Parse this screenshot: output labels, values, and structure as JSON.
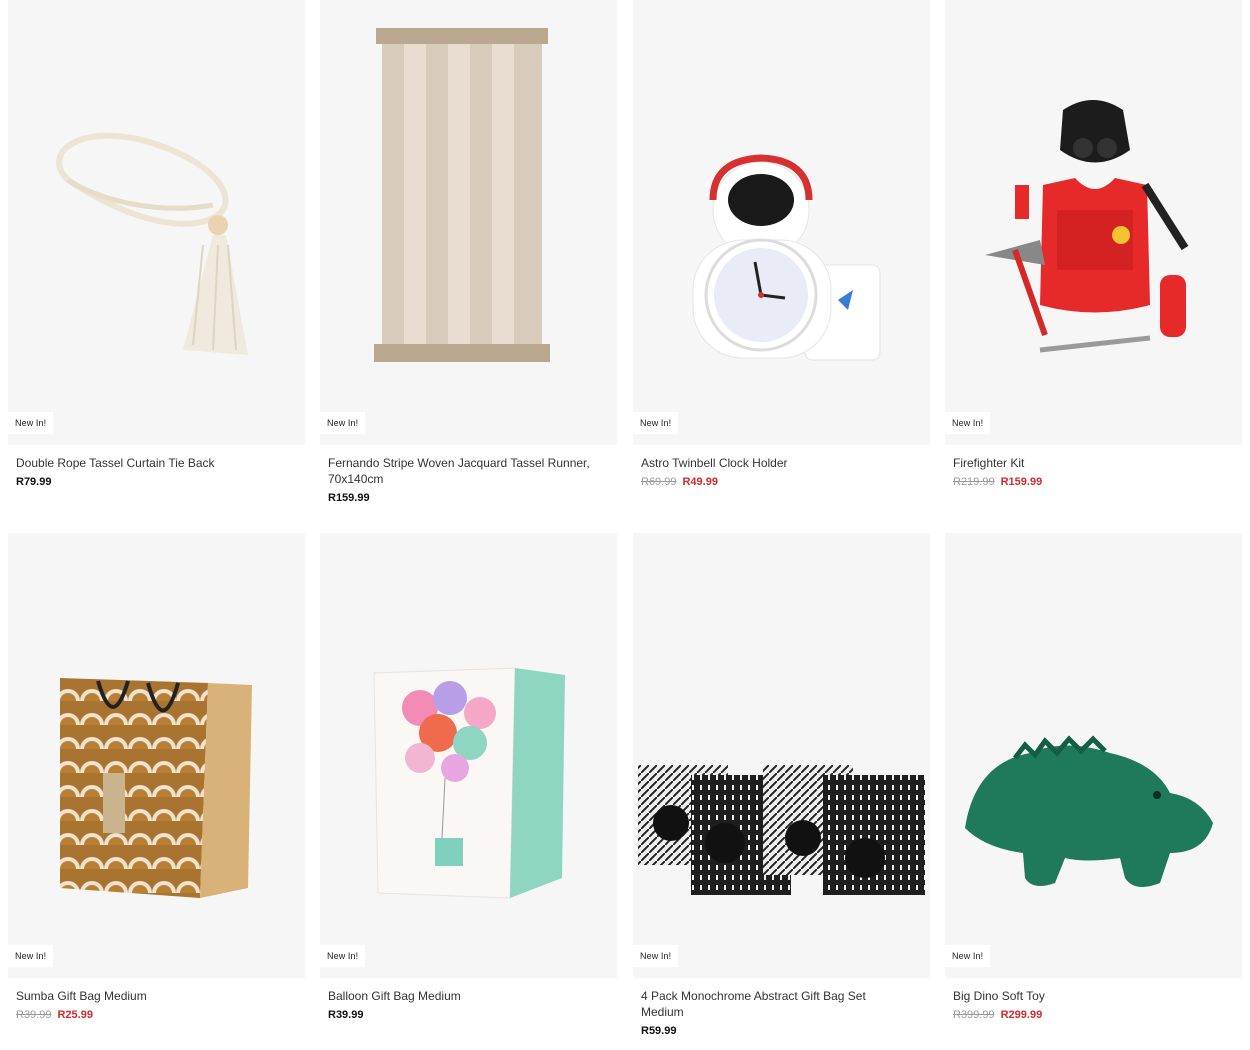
{
  "products": [
    {
      "badge": "New In!",
      "name": "Double Rope Tassel Curtain Tie Back",
      "price": "R79.99",
      "was": "",
      "sale": "",
      "image_icon": "rope-tassel-icon"
    },
    {
      "badge": "New In!",
      "name": "Fernando Stripe Woven Jacquard Tassel Runner, 70x140cm",
      "price": "R159.99",
      "was": "",
      "sale": "",
      "image_icon": "striped-runner-icon"
    },
    {
      "badge": "New In!",
      "name": "Astro Twinbell Clock Holder",
      "price": "",
      "was": "R69.99",
      "sale": "R49.99",
      "image_icon": "astronaut-clock-icon"
    },
    {
      "badge": "New In!",
      "name": "Firefighter Kit",
      "price": "",
      "was": "R219.99",
      "sale": "R159.99",
      "image_icon": "firefighter-kit-icon"
    },
    {
      "badge": "New In!",
      "name": "Sumba Gift Bag Medium",
      "price": "",
      "was": "R39.99",
      "sale": "R25.99",
      "image_icon": "gift-bag-icon"
    },
    {
      "badge": "New In!",
      "name": "Balloon Gift Bag Medium",
      "price": "R39.99",
      "was": "",
      "sale": "",
      "image_icon": "balloon-gift-bag-icon"
    },
    {
      "badge": "New In!",
      "name": "4 Pack Monochrome Abstract Gift Bag Set Medium",
      "price": "R59.99",
      "was": "",
      "sale": "",
      "image_icon": "monochrome-bags-icon"
    },
    {
      "badge": "New In!",
      "name": "Big Dino Soft Toy",
      "price": "",
      "was": "R399.99",
      "sale": "R299.99",
      "image_icon": "dino-toy-icon"
    }
  ],
  "colors": {
    "sale": "#d12a2a",
    "image_bg": "#f6f6f6"
  }
}
